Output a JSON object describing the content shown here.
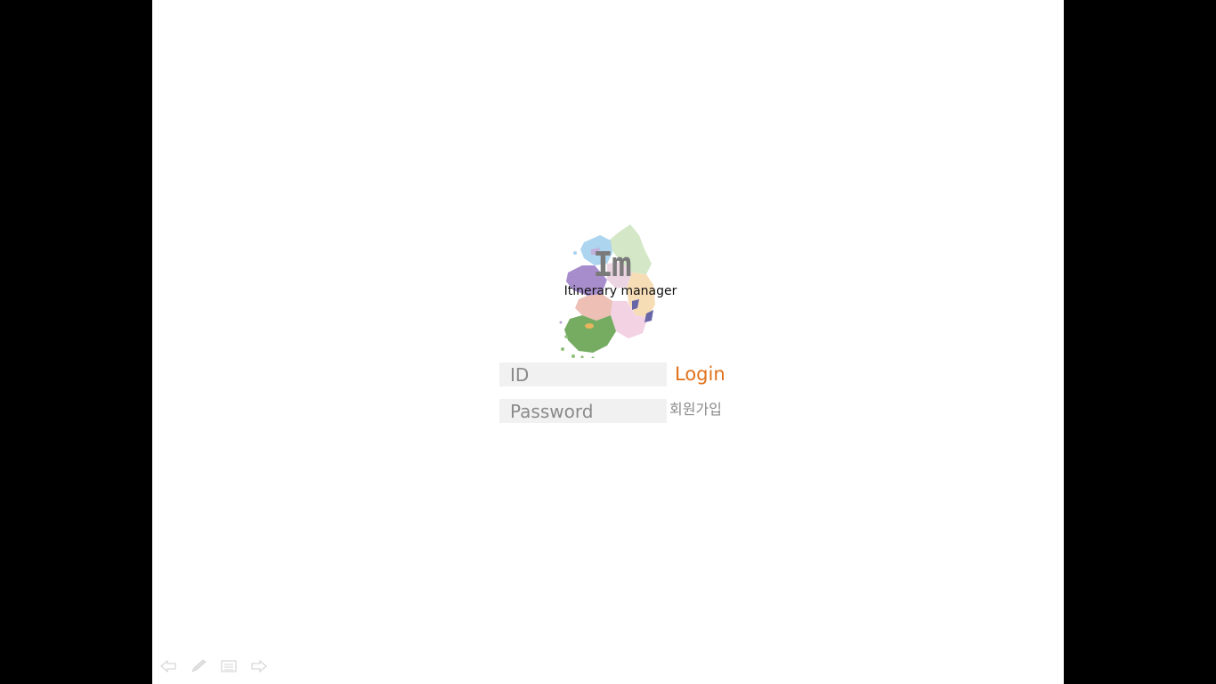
{
  "logo": {
    "mark": "Im",
    "name": "Itinerary manager"
  },
  "login_form": {
    "id_placeholder": "ID",
    "password_placeholder": "Password",
    "login_label": "Login",
    "signup_label": "회원가입"
  },
  "colors": {
    "login_accent": "#e0711b",
    "input_background": "#f1f1f1",
    "letterbox": "#000000"
  },
  "slideshow_controls": {
    "icons": [
      "previous-arrow-icon",
      "pen-icon",
      "menu-icon",
      "next-arrow-icon"
    ]
  }
}
